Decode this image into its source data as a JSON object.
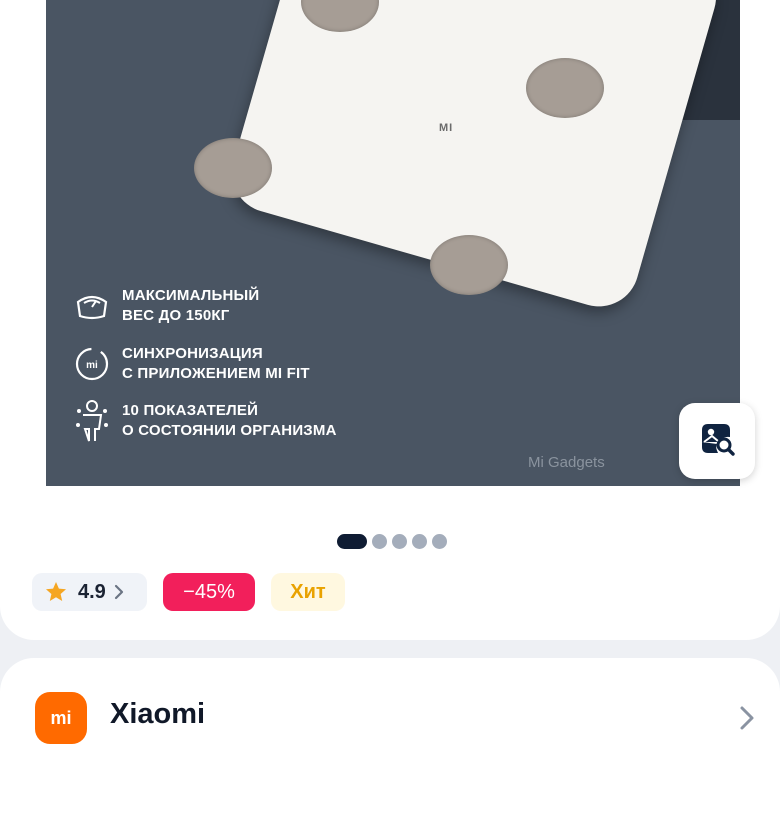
{
  "gallery": {
    "features": [
      {
        "icon": "scale-icon",
        "line1": "МАКСИМАЛЬНЫЙ",
        "line2": "ВЕС ДО 150КГ"
      },
      {
        "icon": "mi-sync-icon",
        "line1": "СИНХРОНИЗАЦИЯ",
        "line2": "С ПРИЛОЖЕНИЕМ MI FIT"
      },
      {
        "icon": "body-metrics-icon",
        "line1": "10 ПОКАЗАТЕЛЕЙ",
        "line2": "О СОСТОЯНИИ ОРГАНИЗМА"
      }
    ],
    "scale_logo": "MI",
    "watermark": "Mi Gadgets",
    "active_slide": 1,
    "slide_count": 5
  },
  "photo_search": {
    "icon": "image-search-icon"
  },
  "badges": {
    "rating": "4.9",
    "discount": "−45%",
    "hit": "Хит"
  },
  "brand": {
    "logo_text": "mi",
    "name": "Xiaomi"
  },
  "colors": {
    "discount_bg": "#f21f5b",
    "hit_text": "#e9a200",
    "brand_orange": "#ff6a00",
    "star": "#f5a623"
  }
}
